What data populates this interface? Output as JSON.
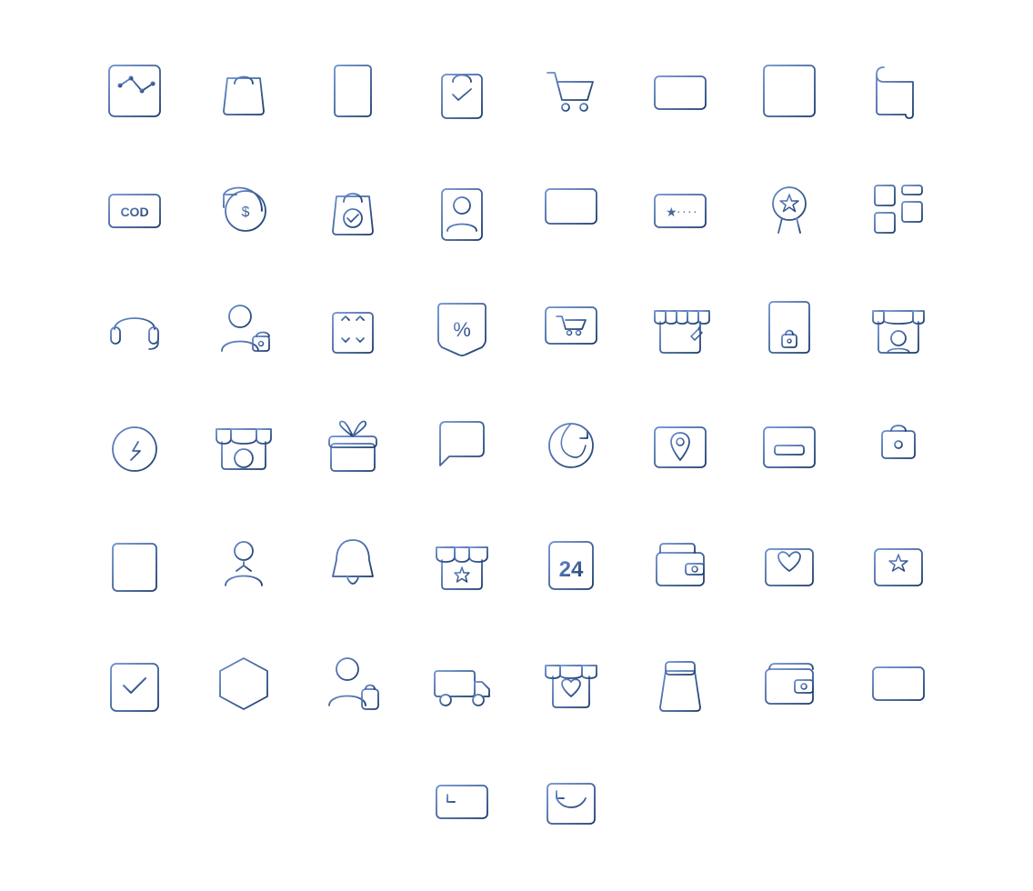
{
  "icons": [
    {
      "name": "analytics-chart-icon",
      "row": 1,
      "col": 1
    },
    {
      "name": "shopping-bag-icon",
      "row": 1,
      "col": 2
    },
    {
      "name": "receipt-icon",
      "row": 1,
      "col": 3
    },
    {
      "name": "order-confirmed-icon",
      "row": 1,
      "col": 4
    },
    {
      "name": "shopping-cart-icon",
      "row": 1,
      "col": 5
    },
    {
      "name": "credit-card-icon",
      "row": 1,
      "col": 6
    },
    {
      "name": "barcode-icon",
      "row": 1,
      "col": 7
    },
    {
      "name": "scroll-document-icon",
      "row": 1,
      "col": 8
    },
    {
      "name": "cod-icon",
      "row": 2,
      "col": 1
    },
    {
      "name": "refund-icon",
      "row": 2,
      "col": 2
    },
    {
      "name": "bag-check-icon",
      "row": 2,
      "col": 3
    },
    {
      "name": "user-card-icon",
      "row": 2,
      "col": 4
    },
    {
      "name": "monitor-icon",
      "row": 2,
      "col": 5
    },
    {
      "name": "loyalty-card-icon",
      "row": 2,
      "col": 6
    },
    {
      "name": "award-star-icon",
      "row": 2,
      "col": 7
    },
    {
      "name": "layout-grid-icon",
      "row": 2,
      "col": 8
    },
    {
      "name": "headset-icon",
      "row": 3,
      "col": 1
    },
    {
      "name": "user-lock-icon",
      "row": 3,
      "col": 2
    },
    {
      "name": "package-icon",
      "row": 3,
      "col": 3
    },
    {
      "name": "discount-tag-icon",
      "row": 3,
      "col": 4
    },
    {
      "name": "cart-screen-icon",
      "row": 3,
      "col": 5
    },
    {
      "name": "store-edit-icon",
      "row": 3,
      "col": 6
    },
    {
      "name": "document-lock-icon",
      "row": 3,
      "col": 7
    },
    {
      "name": "shop-user-icon",
      "row": 3,
      "col": 8
    },
    {
      "name": "flash-timer-icon",
      "row": 4,
      "col": 1
    },
    {
      "name": "store-add-icon",
      "row": 4,
      "col": 2
    },
    {
      "name": "gift-icon",
      "row": 4,
      "col": 3
    },
    {
      "name": "chat-icon",
      "row": 4,
      "col": 4
    },
    {
      "name": "global-refresh-icon",
      "row": 4,
      "col": 5
    },
    {
      "name": "location-map-icon",
      "row": 4,
      "col": 6
    },
    {
      "name": "scale-icon",
      "row": 4,
      "col": 7
    },
    {
      "name": "locker-icon",
      "row": 4,
      "col": 8
    },
    {
      "name": "list-icon",
      "row": 5,
      "col": 1
    },
    {
      "name": "location-person-icon",
      "row": 5,
      "col": 2
    },
    {
      "name": "bell-icon",
      "row": 5,
      "col": 3
    },
    {
      "name": "star-store-icon",
      "row": 5,
      "col": 4
    },
    {
      "name": "24hours-icon",
      "row": 5,
      "col": 5
    },
    {
      "name": "wallet-receipt-icon",
      "row": 5,
      "col": 6
    },
    {
      "name": "heart-wallet-icon",
      "row": 5,
      "col": 7
    },
    {
      "name": "star-wallet-icon",
      "row": 5,
      "col": 8
    },
    {
      "name": "confirmed-box-icon",
      "row": 6,
      "col": 1
    },
    {
      "name": "box-3d-icon",
      "row": 6,
      "col": 2
    },
    {
      "name": "user-bag-icon",
      "row": 6,
      "col": 3
    },
    {
      "name": "delivery-truck-icon",
      "row": 6,
      "col": 4
    },
    {
      "name": "heart-store-icon",
      "row": 6,
      "col": 5
    },
    {
      "name": "takeout-bag-icon",
      "row": 6,
      "col": 6
    },
    {
      "name": "wallet-icon",
      "row": 6,
      "col": 7
    },
    {
      "name": "card-fold-icon",
      "row": 6,
      "col": 8
    },
    {
      "name": "card-back-icon",
      "row": 7,
      "col": 4
    },
    {
      "name": "return-box-icon",
      "row": 7,
      "col": 5
    }
  ]
}
